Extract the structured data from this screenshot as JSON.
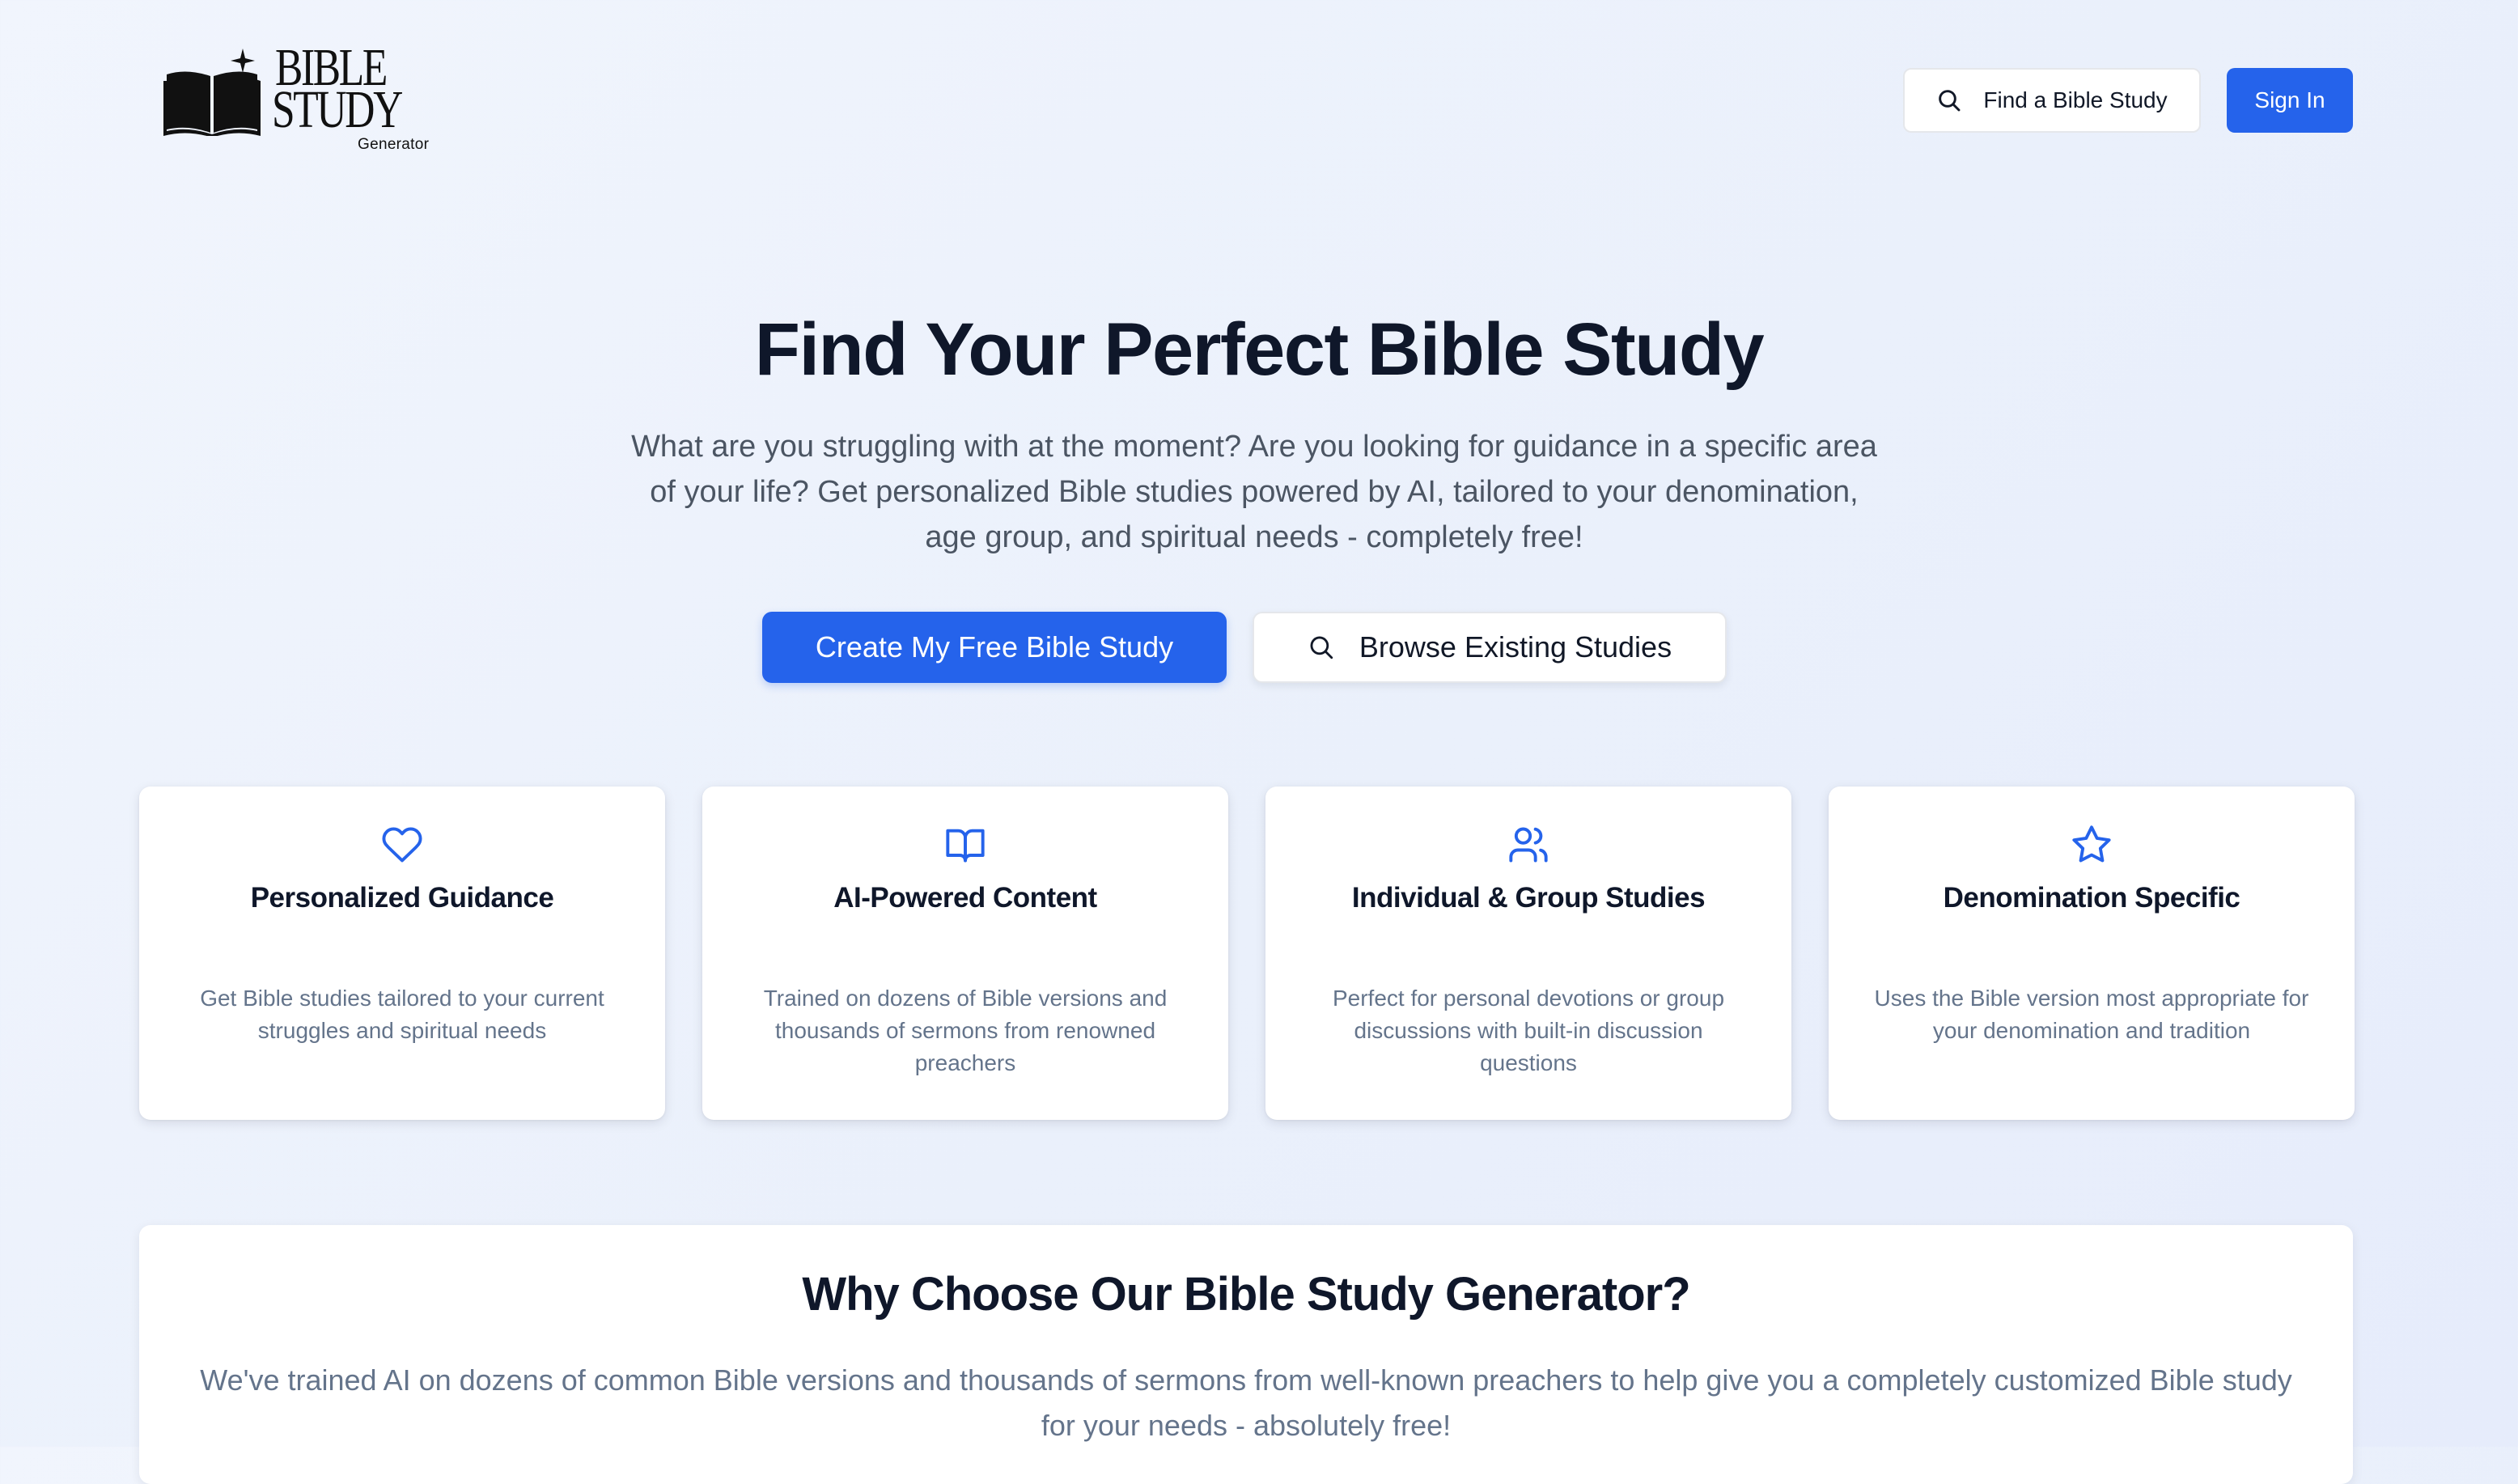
{
  "header": {
    "logo": {
      "line1": "BIBLE",
      "line2": "STUDY",
      "tagline": "Generator"
    },
    "find_button": "Find a Bible Study",
    "signin_button": "Sign In"
  },
  "hero": {
    "title": "Find Your Perfect Bible Study",
    "subtitle": "What are you struggling with at the moment? Are you looking for guidance in a specific area of your life? Get personalized Bible studies powered by AI, tailored to your denomination, age group, and spiritual needs - completely free!",
    "primary_cta": "Create My Free Bible Study",
    "secondary_cta": "Browse Existing Studies"
  },
  "features": [
    {
      "icon": "heart-icon",
      "title": "Personalized Guidance",
      "description": "Get Bible studies tailored to your current struggles and spiritual needs"
    },
    {
      "icon": "open-book-icon",
      "title": "AI-Powered Content",
      "description": "Trained on dozens of Bible versions and thousands of sermons from renowned preachers"
    },
    {
      "icon": "users-icon",
      "title": "Individual & Group Studies",
      "description": "Perfect for personal devotions or group discussions with built-in discussion questions"
    },
    {
      "icon": "star-icon",
      "title": "Denomination Specific",
      "description": "Uses the Bible version most appropriate for your denomination and tradition"
    }
  ],
  "why": {
    "title": "Why Choose Our Bible Study Generator?",
    "text": "We've trained AI on dozens of common Bible versions and thousands of sermons from well-known preachers to help give you a completely customized Bible study for your needs - absolutely free!"
  },
  "colors": {
    "accent": "#2563eb",
    "heading": "#0f172a",
    "body_text": "#4b5563",
    "muted_text": "#64748b",
    "background": "#eef2fc"
  }
}
